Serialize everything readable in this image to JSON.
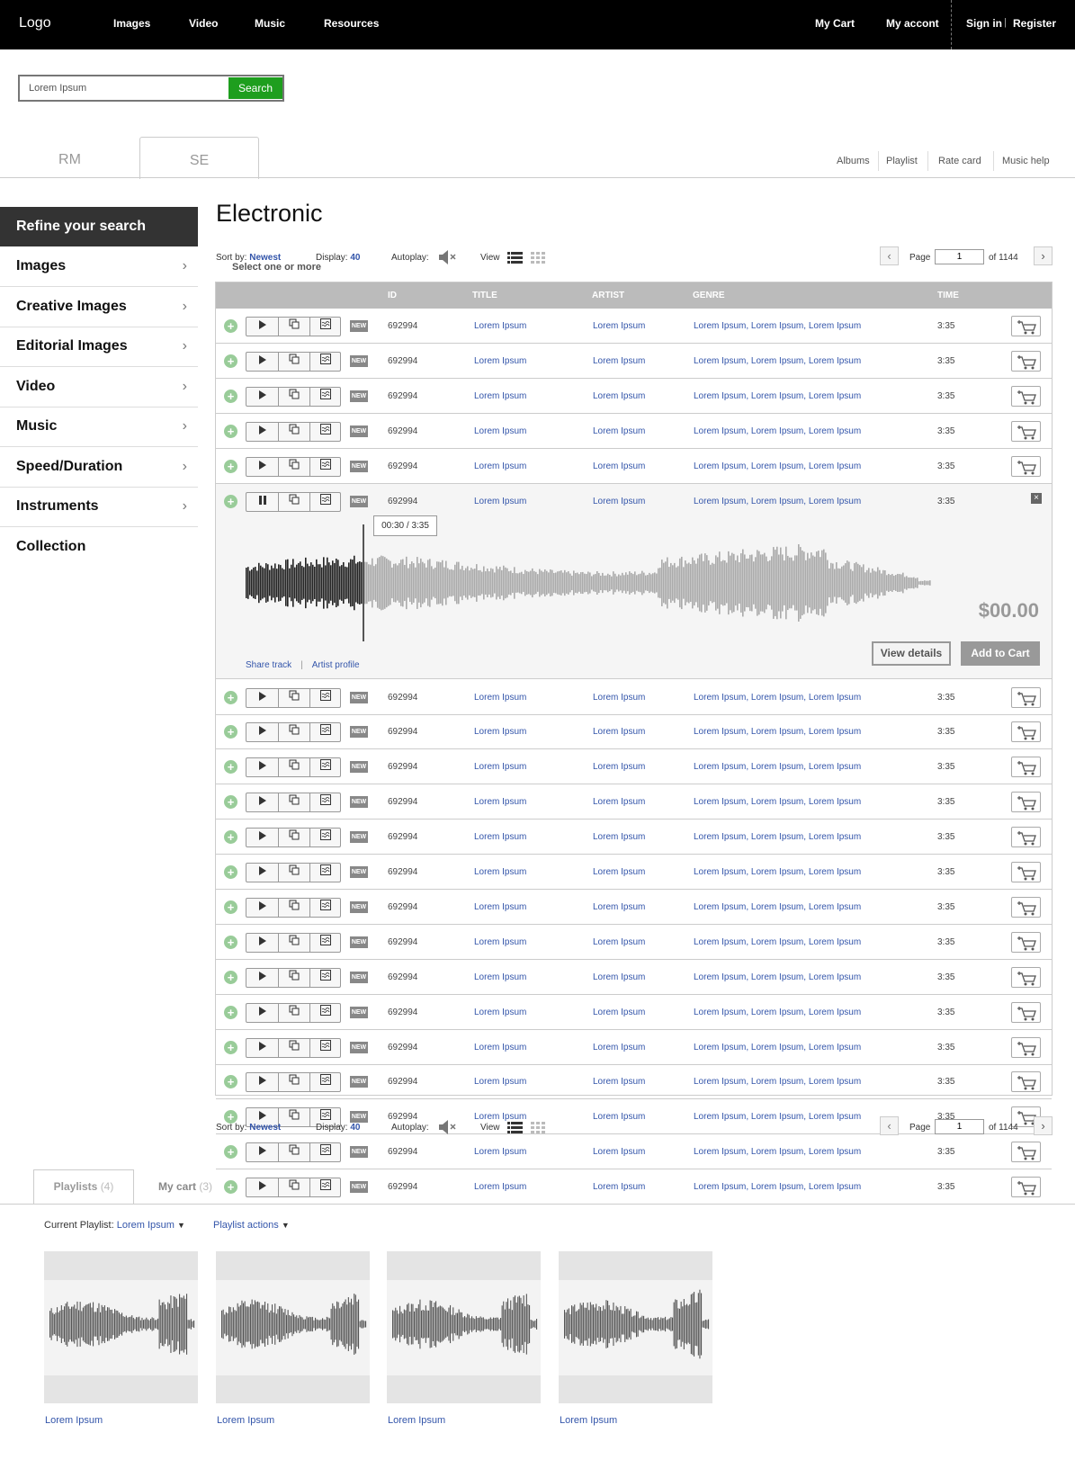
{
  "header": {
    "logo": "Logo",
    "nav": [
      "Images",
      "Video",
      "Music",
      "Resources"
    ],
    "right": [
      "My Cart",
      "My accont"
    ],
    "signin": "Sign in",
    "register": "Register",
    "pipe": "|"
  },
  "search": {
    "value": "Lorem Ipsum",
    "button": "Search"
  },
  "tabs": {
    "rm": "RM",
    "se": "SE"
  },
  "sublinks": [
    "Albums",
    "Playlist",
    "Rate card",
    "Music help"
  ],
  "sidebar": {
    "title": "Refine your search",
    "items": [
      "Images",
      "Creative Images",
      "Editorial Images",
      "Video",
      "Music",
      "Speed/Duration",
      "Instruments",
      "Collection"
    ],
    "chevron": "›"
  },
  "main": {
    "title": "Electronic",
    "sort_label": "Sort by:",
    "sort_value": "Newest",
    "display_label": "Display:",
    "display_value": "40",
    "autoplay_label": "Autoplay:",
    "view_label": "View",
    "hint": "Select one or more",
    "page_label": "Page",
    "page_value": "1",
    "of_label": "of",
    "total_pages": "1144",
    "prev": "‹",
    "next": "›"
  },
  "table": {
    "headers": [
      "ID",
      "TITLE",
      "ARTIST",
      "GENRE",
      "TIME"
    ],
    "rows": [
      {
        "id": "692994",
        "title": "Lorem Ipsum",
        "artist": "Lorem Ipsum",
        "genre": "Lorem Ipsum, Lorem Ipsum, Lorem Ipsum",
        "time": "3:35"
      },
      {
        "id": "692994",
        "title": "Lorem Ipsum",
        "artist": "Lorem Ipsum",
        "genre": "Lorem Ipsum, Lorem Ipsum, Lorem Ipsum",
        "time": "3:35"
      },
      {
        "id": "692994",
        "title": "Lorem Ipsum",
        "artist": "Lorem Ipsum",
        "genre": "Lorem Ipsum, Lorem Ipsum, Lorem Ipsum",
        "time": "3:35"
      },
      {
        "id": "692994",
        "title": "Lorem Ipsum",
        "artist": "Lorem Ipsum",
        "genre": "Lorem Ipsum, Lorem Ipsum, Lorem Ipsum",
        "time": "3:35"
      },
      {
        "id": "692994",
        "title": "Lorem Ipsum",
        "artist": "Lorem Ipsum",
        "genre": "Lorem Ipsum, Lorem Ipsum, Lorem Ipsum",
        "time": "3:35"
      },
      {
        "id": "692994",
        "title": "Lorem Ipsum",
        "artist": "Lorem Ipsum",
        "genre": "Lorem Ipsum, Lorem Ipsum, Lorem Ipsum",
        "time": "3:35",
        "expanded": true
      },
      {
        "id": "692994",
        "title": "Lorem Ipsum",
        "artist": "Lorem Ipsum",
        "genre": "Lorem Ipsum, Lorem Ipsum, Lorem Ipsum",
        "time": "3:35"
      },
      {
        "id": "692994",
        "title": "Lorem Ipsum",
        "artist": "Lorem Ipsum",
        "genre": "Lorem Ipsum, Lorem Ipsum, Lorem Ipsum",
        "time": "3:35"
      },
      {
        "id": "692994",
        "title": "Lorem Ipsum",
        "artist": "Lorem Ipsum",
        "genre": "Lorem Ipsum, Lorem Ipsum, Lorem Ipsum",
        "time": "3:35"
      },
      {
        "id": "692994",
        "title": "Lorem Ipsum",
        "artist": "Lorem Ipsum",
        "genre": "Lorem Ipsum, Lorem Ipsum, Lorem Ipsum",
        "time": "3:35"
      },
      {
        "id": "692994",
        "title": "Lorem Ipsum",
        "artist": "Lorem Ipsum",
        "genre": "Lorem Ipsum, Lorem Ipsum, Lorem Ipsum",
        "time": "3:35"
      },
      {
        "id": "692994",
        "title": "Lorem Ipsum",
        "artist": "Lorem Ipsum",
        "genre": "Lorem Ipsum, Lorem Ipsum, Lorem Ipsum",
        "time": "3:35"
      },
      {
        "id": "692994",
        "title": "Lorem Ipsum",
        "artist": "Lorem Ipsum",
        "genre": "Lorem Ipsum, Lorem Ipsum, Lorem Ipsum",
        "time": "3:35"
      },
      {
        "id": "692994",
        "title": "Lorem Ipsum",
        "artist": "Lorem Ipsum",
        "genre": "Lorem Ipsum, Lorem Ipsum, Lorem Ipsum",
        "time": "3:35"
      },
      {
        "id": "692994",
        "title": "Lorem Ipsum",
        "artist": "Lorem Ipsum",
        "genre": "Lorem Ipsum, Lorem Ipsum, Lorem Ipsum",
        "time": "3:35"
      },
      {
        "id": "692994",
        "title": "Lorem Ipsum",
        "artist": "Lorem Ipsum",
        "genre": "Lorem Ipsum, Lorem Ipsum, Lorem Ipsum",
        "time": "3:35"
      },
      {
        "id": "692994",
        "title": "Lorem Ipsum",
        "artist": "Lorem Ipsum",
        "genre": "Lorem Ipsum, Lorem Ipsum, Lorem Ipsum",
        "time": "3:35"
      },
      {
        "id": "692994",
        "title": "Lorem Ipsum",
        "artist": "Lorem Ipsum",
        "genre": "Lorem Ipsum, Lorem Ipsum, Lorem Ipsum",
        "time": "3:35"
      },
      {
        "id": "692994",
        "title": "Lorem Ipsum",
        "artist": "Lorem Ipsum",
        "genre": "Lorem Ipsum, Lorem Ipsum, Lorem Ipsum",
        "time": "3:35"
      },
      {
        "id": "692994",
        "title": "Lorem Ipsum",
        "artist": "Lorem Ipsum",
        "genre": "Lorem Ipsum, Lorem Ipsum, Lorem Ipsum",
        "time": "3:35"
      },
      {
        "id": "692994",
        "title": "Lorem Ipsum",
        "artist": "Lorem Ipsum",
        "genre": "Lorem Ipsum, Lorem Ipsum, Lorem Ipsum",
        "time": "3:35"
      }
    ],
    "new_badge": "NEW"
  },
  "player": {
    "time_tooltip": "00:30 / 3:35",
    "played_fraction": 0.17,
    "price": "$00.00",
    "view_details": "View details",
    "add_to_cart": "Add to Cart",
    "share_track": "Share track",
    "artist_profile": "Artist profile",
    "separator": "|"
  },
  "playlists": {
    "tab_label": "Playlists",
    "tab_count": "(4)",
    "cart_label": "My cart",
    "cart_count": "(3)",
    "current_label": "Current Playlist:",
    "current_value": "Lorem Ipsum",
    "actions": "Playlist actions",
    "items": [
      "Lorem Ipsum",
      "Lorem Ipsum",
      "Lorem Ipsum",
      "Lorem Ipsum"
    ]
  },
  "colors": {
    "accent_link": "#3355aa",
    "search_green": "#1e9e1e",
    "header_bg": "#000000"
  },
  "icons": [
    "plus-circle-icon",
    "play-icon",
    "pause-icon",
    "copy-icon",
    "waveform-icon",
    "cart-icon",
    "speaker-mute-icon",
    "list-view-icon",
    "grid-view-icon",
    "close-icon",
    "chevron-right-icon",
    "dropdown-arrow-icon"
  ]
}
